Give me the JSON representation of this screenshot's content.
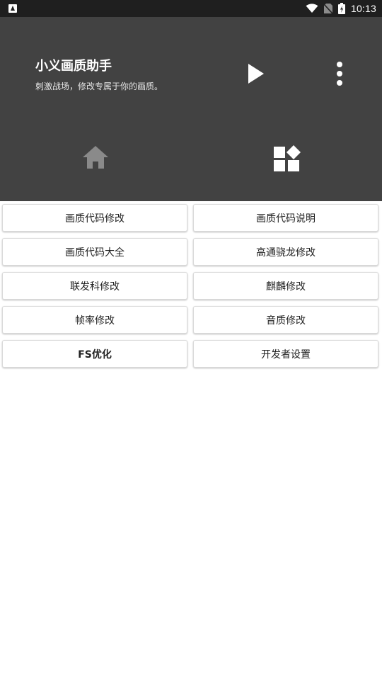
{
  "status_bar": {
    "time": "10:13",
    "icons": [
      "notification-icon",
      "wifi-icon",
      "no-sim-icon",
      "battery-charging-icon"
    ]
  },
  "header": {
    "title": "小义画质助手",
    "subtitle": "刺激战场，修改专属于你的画质。",
    "background": "#424242",
    "icons": [
      "play-icon",
      "more-vert-icon",
      "home-icon",
      "widgets-icon"
    ]
  },
  "buttons": [
    {
      "label": "画质代码修改"
    },
    {
      "label": "画质代码说明"
    },
    {
      "label": "画质代码大全"
    },
    {
      "label": "高通骁龙修改"
    },
    {
      "label": "联发科修改"
    },
    {
      "label": "麒麟修改"
    },
    {
      "label": "帧率修改"
    },
    {
      "label": "音质修改"
    },
    {
      "label": "FS优化"
    },
    {
      "label": "开发者设置"
    }
  ]
}
